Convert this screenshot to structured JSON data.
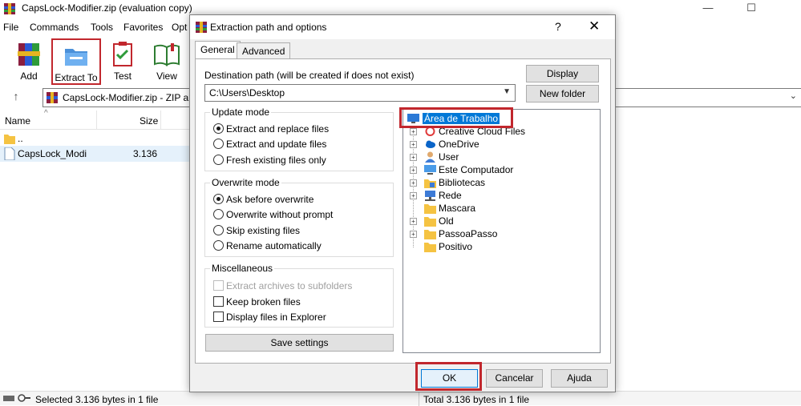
{
  "window": {
    "title": "CapsLock-Modifier.zip (evaluation copy)",
    "minimize": "—",
    "maximize": "☐"
  },
  "menu": [
    "File",
    "Commands",
    "Tools",
    "Favorites",
    "Opt"
  ],
  "toolbar": {
    "add": "Add",
    "extract_to": "Extract To",
    "test": "Test",
    "view": "View"
  },
  "address": {
    "text": "CapsLock-Modifier.zip - ZIP ar"
  },
  "filelist": {
    "col_name": "Name",
    "col_size": "Size",
    "rows": [
      {
        "name": "..",
        "size": ""
      },
      {
        "name": "CapsLock_Modi",
        "size": "3.136"
      }
    ]
  },
  "status": {
    "left": "Selected 3.136 bytes in 1 file",
    "right": "Total 3.136 bytes in 1 file"
  },
  "dialog": {
    "title": "Extraction path and options",
    "help_glyph": "?",
    "close_glyph": "✕",
    "tabs": [
      "General",
      "Advanced"
    ],
    "dest_label": "Destination path (will be created if does not exist)",
    "dest_value": "C:\\Users\\Desktop",
    "display_button": "Display",
    "new_folder_button": "New folder",
    "update_mode": {
      "title": "Update mode",
      "options": [
        {
          "label": "Extract and replace files",
          "selected": true
        },
        {
          "label": "Extract and update files",
          "selected": false
        },
        {
          "label": "Fresh existing files only",
          "selected": false
        }
      ]
    },
    "overwrite_mode": {
      "title": "Overwrite mode",
      "options": [
        {
          "label": "Ask before overwrite",
          "selected": true
        },
        {
          "label": "Overwrite without prompt",
          "selected": false
        },
        {
          "label": "Skip existing files",
          "selected": false
        },
        {
          "label": "Rename automatically",
          "selected": false
        }
      ]
    },
    "misc": {
      "title": "Miscellaneous",
      "options": [
        {
          "label": "Extract archives to subfolders",
          "checked": false,
          "disabled": true
        },
        {
          "label": "Keep broken files",
          "checked": false,
          "disabled": false
        },
        {
          "label": "Display files in Explorer",
          "checked": false,
          "disabled": false
        }
      ]
    },
    "save_settings": "Save settings",
    "tree": {
      "root": "Área de Trabalho",
      "items": [
        {
          "label": "Creative Cloud Files",
          "icon": "creative-cloud-icon",
          "expandable": true
        },
        {
          "label": "OneDrive",
          "icon": "cloud-icon",
          "expandable": true
        },
        {
          "label": "User",
          "icon": "user-icon",
          "expandable": true
        },
        {
          "label": "Este Computador",
          "icon": "computer-icon",
          "expandable": true
        },
        {
          "label": "Bibliotecas",
          "icon": "library-icon",
          "expandable": true
        },
        {
          "label": "Rede",
          "icon": "network-icon",
          "expandable": true
        },
        {
          "label": "Mascara",
          "icon": "folder-icon",
          "expandable": false
        },
        {
          "label": "Old",
          "icon": "folder-icon",
          "expandable": true
        },
        {
          "label": "PassoaPasso",
          "icon": "folder-icon",
          "expandable": true
        },
        {
          "label": "Positivo",
          "icon": "folder-icon",
          "expandable": false
        }
      ]
    },
    "ok": "OK",
    "cancel": "Cancelar",
    "help": "Ajuda"
  },
  "colors": {
    "highlight": "#c1272d",
    "selection": "#0078d7",
    "dialog_bg": "#f0f0f0"
  }
}
